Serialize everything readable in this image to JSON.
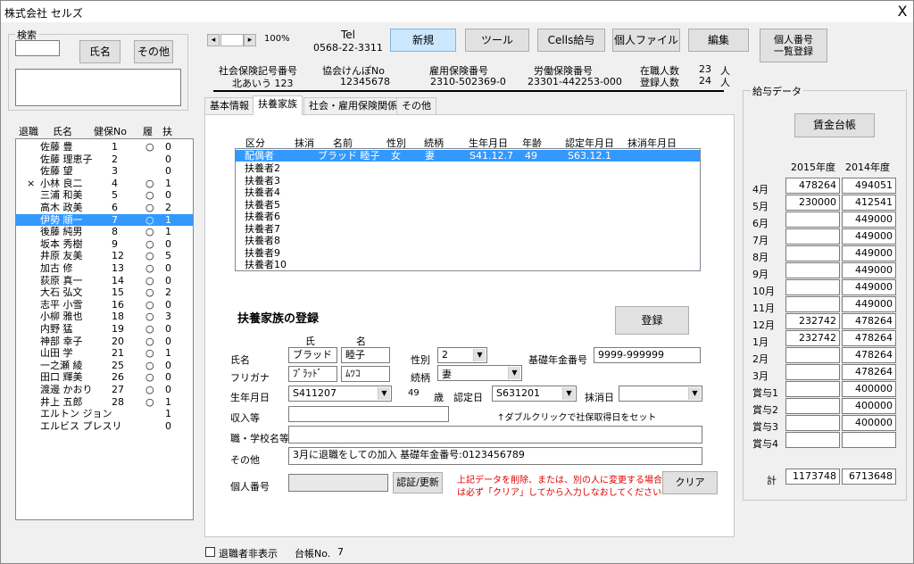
{
  "window": {
    "title": "株式会社 セルズ",
    "close": "X"
  },
  "search": {
    "legend": "検索",
    "input_value": "",
    "name_btn": "氏名",
    "other_btn": "その他"
  },
  "emp_list": {
    "headers": [
      "退職",
      "氏名",
      "健保No",
      "履",
      "扶"
    ],
    "rows": [
      {
        "retired": "",
        "name": "佐藤 豊",
        "no": "1",
        "ri": "○",
        "fu": "0"
      },
      {
        "retired": "",
        "name": "佐藤 理恵子",
        "no": "2",
        "ri": "",
        "fu": "0"
      },
      {
        "retired": "",
        "name": "佐藤 望",
        "no": "3",
        "ri": "",
        "fu": "0"
      },
      {
        "retired": "×",
        "name": "小林 良二",
        "no": "4",
        "ri": "○",
        "fu": "1"
      },
      {
        "retired": "",
        "name": "三浦 和美",
        "no": "5",
        "ri": "○",
        "fu": "0"
      },
      {
        "retired": "",
        "name": "高木 政美",
        "no": "6",
        "ri": "○",
        "fu": "2"
      },
      {
        "retired": "",
        "name": "伊勢 順一",
        "no": "7",
        "ri": "○",
        "fu": "1"
      },
      {
        "retired": "",
        "name": "後藤 純男",
        "no": "8",
        "ri": "○",
        "fu": "1"
      },
      {
        "retired": "",
        "name": "坂本 秀樹",
        "no": "9",
        "ri": "○",
        "fu": "0"
      },
      {
        "retired": "",
        "name": "井原 友美",
        "no": "12",
        "ri": "○",
        "fu": "5"
      },
      {
        "retired": "",
        "name": "加古 修",
        "no": "13",
        "ri": "○",
        "fu": "0"
      },
      {
        "retired": "",
        "name": "荻原 真一",
        "no": "14",
        "ri": "○",
        "fu": "0"
      },
      {
        "retired": "",
        "name": "大石 弘文",
        "no": "15",
        "ri": "○",
        "fu": "2"
      },
      {
        "retired": "",
        "name": "志平 小雪",
        "no": "16",
        "ri": "○",
        "fu": "0"
      },
      {
        "retired": "",
        "name": "小柳 雅也",
        "no": "18",
        "ri": "○",
        "fu": "3"
      },
      {
        "retired": "",
        "name": "内野 猛",
        "no": "19",
        "ri": "○",
        "fu": "0"
      },
      {
        "retired": "",
        "name": "神部 幸子",
        "no": "20",
        "ri": "○",
        "fu": "0"
      },
      {
        "retired": "",
        "name": "山田 学",
        "no": "21",
        "ri": "○",
        "fu": "1"
      },
      {
        "retired": "",
        "name": "一之瀬 綾",
        "no": "25",
        "ri": "○",
        "fu": "0"
      },
      {
        "retired": "",
        "name": "田口 輝美",
        "no": "26",
        "ri": "○",
        "fu": "0"
      },
      {
        "retired": "",
        "name": "渡邊 かおり",
        "no": "27",
        "ri": "○",
        "fu": "0"
      },
      {
        "retired": "",
        "name": "井上 五郎",
        "no": "28",
        "ri": "○",
        "fu": "1"
      },
      {
        "retired": "",
        "name": "エルトン ジョン",
        "no": "",
        "ri": "",
        "fu": "1"
      },
      {
        "retired": "",
        "name": "エルビス プレスリ",
        "no": "",
        "ri": "",
        "fu": "0"
      }
    ],
    "selected_index": 6
  },
  "nav": {
    "prev": "◂",
    "next": "▸",
    "zoom": "100%"
  },
  "tel": {
    "label": "Tel",
    "number": "0568-22-3311"
  },
  "toolbar": {
    "new": "新規",
    "tool": "ツール",
    "cells": "Cells給与",
    "file": "個人ファイル",
    "edit": "編集",
    "mynumber_l1": "個人番号",
    "mynumber_l2": "一覧登録"
  },
  "info": {
    "shaho_label": "社会保険記号番号",
    "shaho_value": "北あいう 123",
    "kyokai_label": "協会けんぽNo",
    "kyokai_value": "12345678",
    "koyou_label": "雇用保険番号",
    "koyou_value": "2310-502369-0",
    "roudou_label": "労働保険番号",
    "roudou_value": "23301-442253-000",
    "zaishoku_label": "在職人数",
    "zaishoku_value": "23",
    "zaishoku_unit": "人",
    "touroku_label": "登録人数",
    "touroku_value": "24",
    "touroku_unit": "人"
  },
  "tabs": [
    "基本情報",
    "扶養家族",
    "社会・雇用保険関係",
    "その他"
  ],
  "dep_list": {
    "headers": [
      "区分",
      "抹消",
      "名前",
      "性別",
      "続柄",
      "生年月日",
      "年齢",
      "認定年月日",
      "抹消年月日"
    ],
    "first": {
      "kubun": "配偶者",
      "name": "ブラッド 睦子",
      "sex": "女",
      "rel": "妻",
      "birth": "S41.12.7",
      "age": "49",
      "nintei": "S63.12.1"
    },
    "rows": [
      "扶養者2",
      "扶養者3",
      "扶養者4",
      "扶養者5",
      "扶養者6",
      "扶養者7",
      "扶養者8",
      "扶養者9",
      "扶養者10"
    ]
  },
  "form": {
    "heading": "扶養家族の登録",
    "register_btn": "登録",
    "sei_label": "氏",
    "mei_label": "名",
    "name_label": "氏名",
    "sei": "ブラッド",
    "mei": "睦子",
    "sex_label": "性別",
    "sex": "2",
    "kiso_label": "基礎年金番号",
    "kiso": "9999-999999",
    "furi_label": "フリガナ",
    "furi_sei": "ﾌﾞﾗｯﾄﾞ",
    "furi_mei": "ﾑﾂｺ",
    "rel_label": "続柄",
    "rel": "妻",
    "birth_label": "生年月日",
    "birth": "S411207",
    "age": "49",
    "age_unit": "歳",
    "nintei_label": "認定日",
    "nintei": "S631201",
    "massho_label": "抹消日",
    "massho": "",
    "income_label": "収入等",
    "income": "",
    "hint": "↑ダブルクリックで社保取得日をセット",
    "school_label": "職・学校名等",
    "school": "",
    "other_label": "その他",
    "other": "3月に退職をしての加入 基礎年金番号:0123456789",
    "mynum_label": "個人番号",
    "mynum": "",
    "update_btn": "認証/更新",
    "warn1": "上記データを削除、または、別の人に変更する場合",
    "warn2": "は必ず「クリア」してから入力しなおしてください⇒⇒",
    "clear_btn": "クリア"
  },
  "salary": {
    "legend": "給与データ",
    "ledger_btn": "賃金台帳",
    "col1": "2015年度",
    "col2": "2014年度",
    "rows": [
      {
        "m": "4月",
        "a": "478264",
        "b": "494051"
      },
      {
        "m": "5月",
        "a": "230000",
        "b": "412541"
      },
      {
        "m": "6月",
        "a": "",
        "b": "449000"
      },
      {
        "m": "7月",
        "a": "",
        "b": "449000"
      },
      {
        "m": "8月",
        "a": "",
        "b": "449000"
      },
      {
        "m": "9月",
        "a": "",
        "b": "449000"
      },
      {
        "m": "10月",
        "a": "",
        "b": "449000"
      },
      {
        "m": "11月",
        "a": "",
        "b": "449000"
      },
      {
        "m": "12月",
        "a": "232742",
        "b": "478264"
      },
      {
        "m": "1月",
        "a": "232742",
        "b": "478264"
      },
      {
        "m": "2月",
        "a": "",
        "b": "478264"
      },
      {
        "m": "3月",
        "a": "",
        "b": "478264"
      },
      {
        "m": "賞与1",
        "a": "",
        "b": "400000"
      },
      {
        "m": "賞与2",
        "a": "",
        "b": "400000"
      },
      {
        "m": "賞与3",
        "a": "",
        "b": "400000"
      },
      {
        "m": "賞与4",
        "a": "",
        "b": ""
      }
    ],
    "total_label": "計",
    "total_a": "1173748",
    "total_b": "6713648"
  },
  "footer": {
    "hide_retired": "退職者非表示",
    "ledger_no_label": "台帳No.",
    "ledger_no": "7"
  }
}
